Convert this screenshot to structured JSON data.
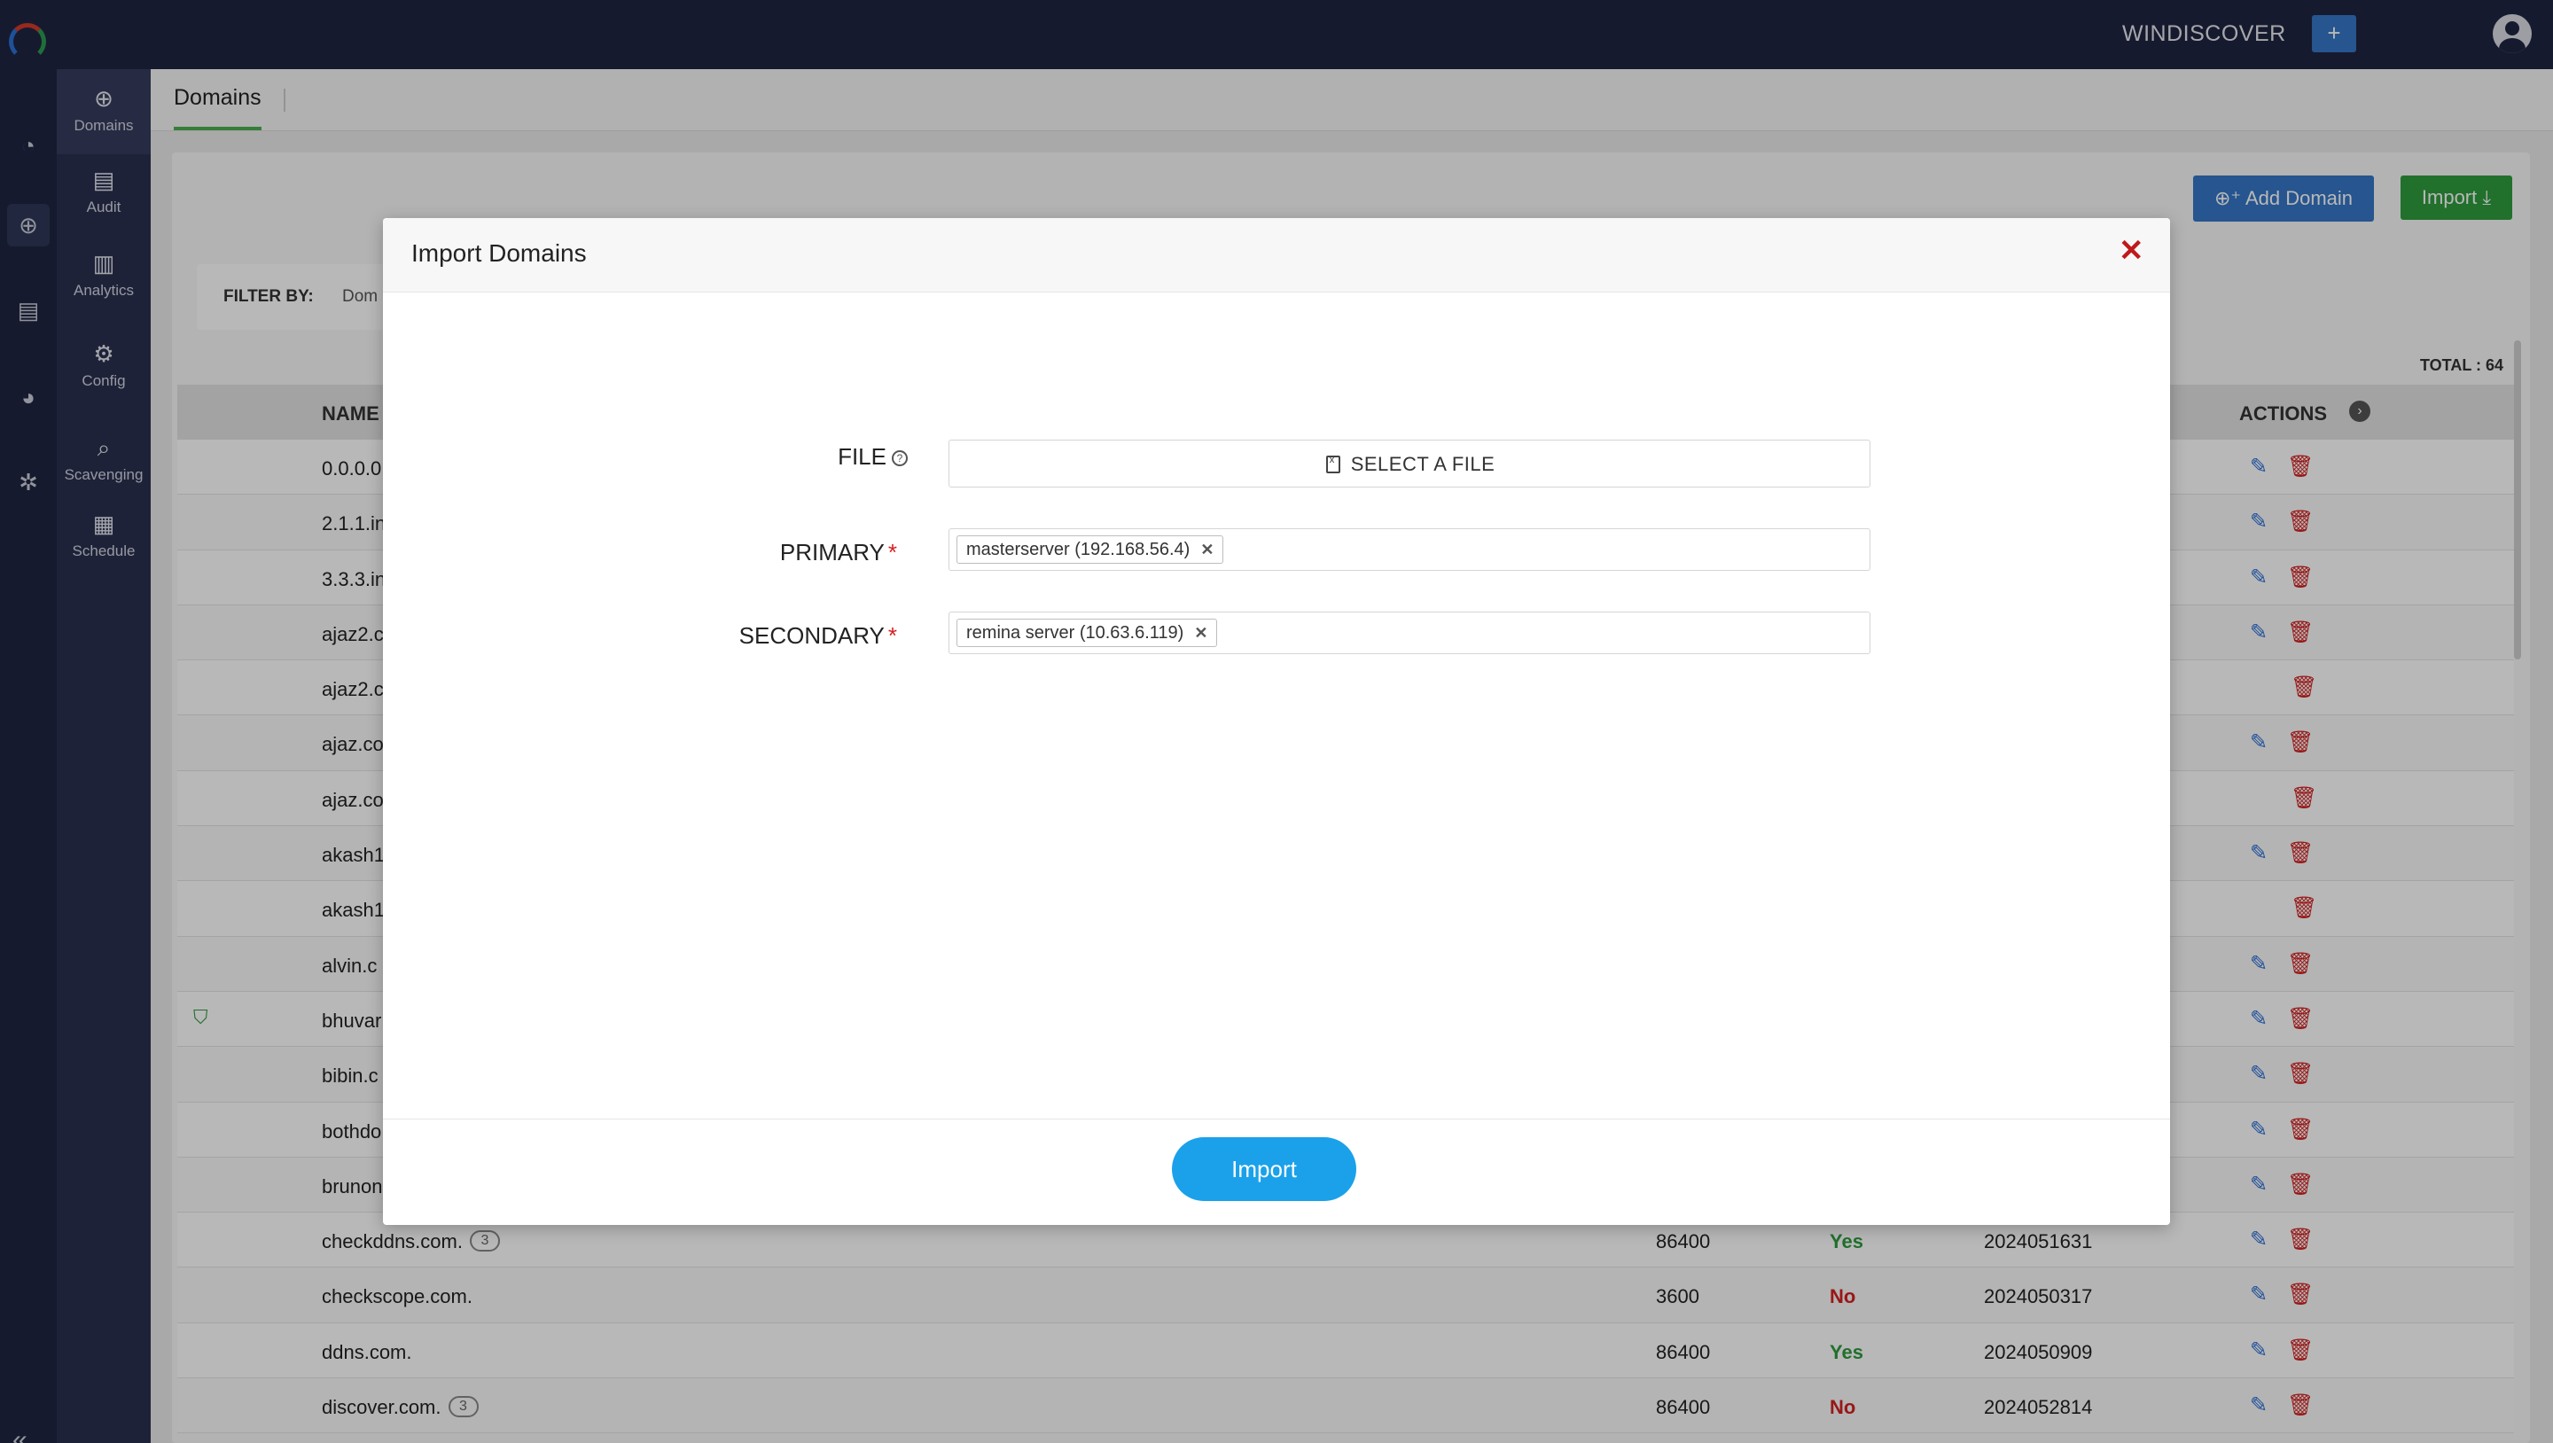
{
  "topbar": {
    "brand": "WINDISCOVER",
    "plus_label": "+"
  },
  "subnav": {
    "items": [
      {
        "label": "Domains",
        "icon": "globe-icon"
      },
      {
        "label": "Audit",
        "icon": "audit-icon"
      },
      {
        "label": "Analytics",
        "icon": "analytics-icon"
      },
      {
        "label": "Config",
        "icon": "config-icon"
      },
      {
        "label": "Scavenging",
        "icon": "scavenging-icon"
      },
      {
        "label": "Schedule",
        "icon": "calendar-icon"
      }
    ]
  },
  "tabs": {
    "active": "Domains"
  },
  "toolbar": {
    "add_domain": "Add Domain",
    "import": "Import"
  },
  "filter": {
    "label": "FILTER BY:",
    "value": "Dom"
  },
  "table": {
    "total": "TOTAL : 64",
    "col_name": "NAME",
    "col_actions": "ACTIONS",
    "rows": [
      {
        "name": "0.0.0.0",
        "ttl": "",
        "dnssec": "",
        "serial": ""
      },
      {
        "name": "2.1.1.in",
        "ttl": "",
        "dnssec": "",
        "serial": ""
      },
      {
        "name": "3.3.3.in",
        "ttl": "",
        "dnssec": "",
        "serial": ""
      },
      {
        "name": "ajaz2.c",
        "ttl": "",
        "dnssec": "",
        "serial": ""
      },
      {
        "name": "ajaz2.c",
        "ttl": "",
        "dnssec": "",
        "serial": ""
      },
      {
        "name": "ajaz.co",
        "ttl": "",
        "dnssec": "",
        "serial": ""
      },
      {
        "name": "ajaz.co",
        "ttl": "",
        "dnssec": "",
        "serial": ""
      },
      {
        "name": "akash1",
        "ttl": "",
        "dnssec": "",
        "serial": ""
      },
      {
        "name": "akash1",
        "ttl": "",
        "dnssec": "",
        "serial": ""
      },
      {
        "name": "alvin.c",
        "ttl": "",
        "dnssec": "",
        "serial": ""
      },
      {
        "name": "bhuvar",
        "ttl": "",
        "dnssec": "",
        "serial": ""
      },
      {
        "name": "bibin.c",
        "ttl": "",
        "dnssec": "",
        "serial": ""
      },
      {
        "name": "bothdo",
        "ttl": "",
        "dnssec": "",
        "serial": ""
      },
      {
        "name": "brunon",
        "ttl": "",
        "dnssec": "",
        "serial": ""
      },
      {
        "name": "checkddns.com.",
        "badge": "3",
        "ttl": "86400",
        "dnssec": "Yes",
        "serial": "2024051631"
      },
      {
        "name": "checkscope.com.",
        "ttl": "3600",
        "dnssec": "No",
        "serial": "2024050317"
      },
      {
        "name": "ddns.com.",
        "ttl": "86400",
        "dnssec": "Yes",
        "serial": "2024050909"
      },
      {
        "name": "discover.com.",
        "badge": "3",
        "ttl": "86400",
        "dnssec": "No",
        "serial": "2024052814"
      }
    ]
  },
  "modal": {
    "title": "Import Domains",
    "file_label": "FILE",
    "file_button": "SELECT A FILE",
    "primary_label": "PRIMARY",
    "primary_tag": "masterserver (192.168.56.4)",
    "secondary_label": "SECONDARY",
    "secondary_tag": "remina server (10.63.6.119)",
    "required_mark": "*",
    "import_button": "Import"
  }
}
